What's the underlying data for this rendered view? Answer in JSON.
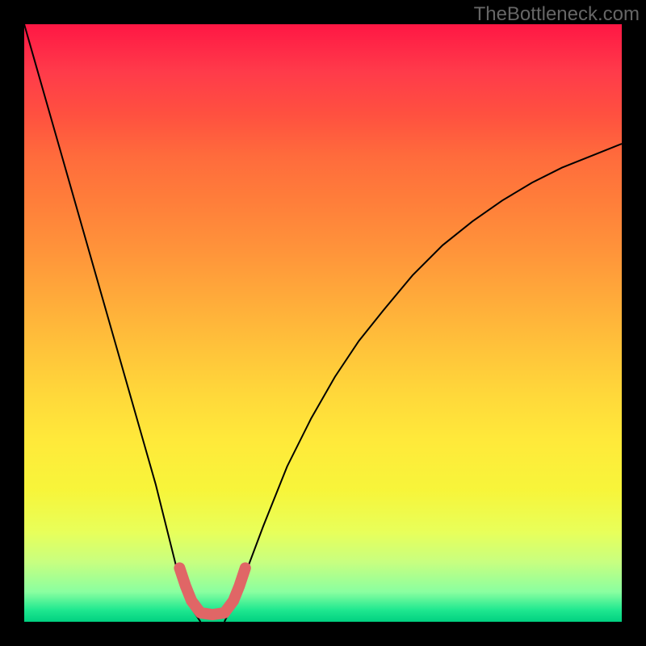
{
  "watermark": "TheBottleneck.com",
  "colors": {
    "background": "#000000",
    "curve": "#000000",
    "highlight": "#e06666"
  },
  "chart_data": {
    "type": "line",
    "title": "",
    "xlabel": "",
    "ylabel": "",
    "xlim": [
      0,
      100
    ],
    "ylim": [
      0,
      100
    ],
    "grid": false,
    "legend": false,
    "series": [
      {
        "name": "left-branch",
        "x": [
          0,
          2,
          4,
          6,
          8,
          10,
          12,
          14,
          16,
          18,
          20,
          22,
          24,
          26,
          27.5,
          29.5
        ],
        "y": [
          100,
          93,
          86,
          79,
          72,
          65,
          58,
          51,
          44,
          37,
          30,
          23,
          15,
          7,
          3,
          0
        ]
      },
      {
        "name": "right-branch",
        "x": [
          33.5,
          35,
          37,
          40,
          44,
          48,
          52,
          56,
          60,
          65,
          70,
          75,
          80,
          85,
          90,
          95,
          100
        ],
        "y": [
          0,
          3,
          8,
          16,
          26,
          34,
          41,
          47,
          52,
          58,
          63,
          67,
          70.5,
          73.5,
          76,
          78,
          80
        ]
      },
      {
        "name": "highlight-region",
        "x": [
          26,
          27,
          28,
          29.5,
          31.5,
          33.5,
          35,
          36,
          37
        ],
        "y": [
          9,
          6,
          3.5,
          1.5,
          1.2,
          1.5,
          3.5,
          6,
          9
        ]
      }
    ]
  }
}
